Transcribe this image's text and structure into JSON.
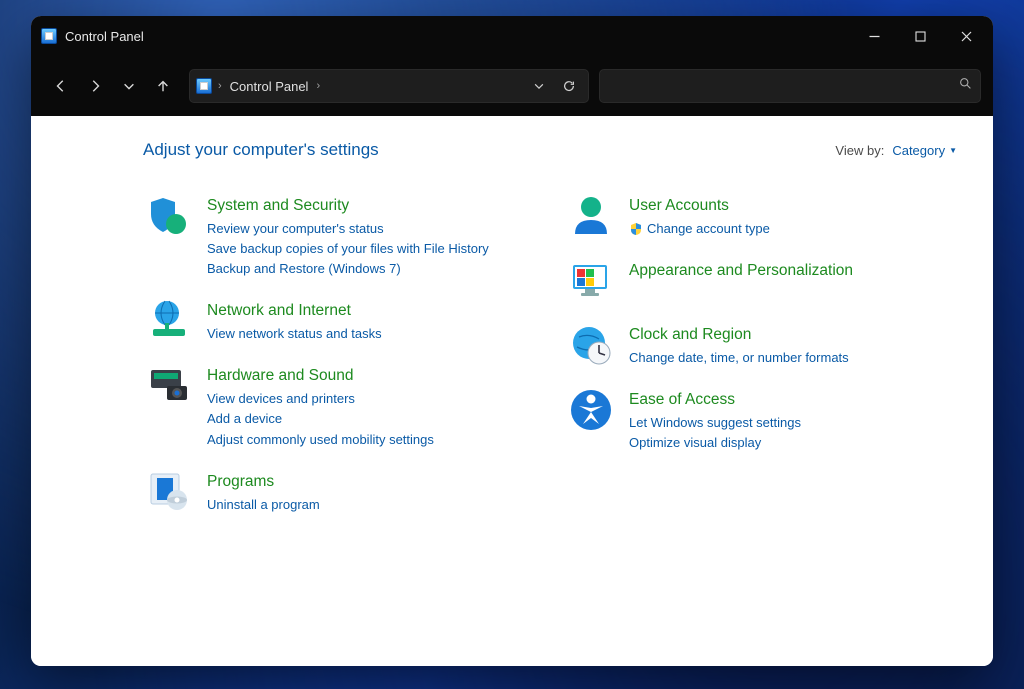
{
  "window": {
    "title": "Control Panel"
  },
  "breadcrumb": {
    "root": "Control Panel"
  },
  "search": {
    "placeholder": ""
  },
  "header": {
    "page_title": "Adjust your computer's settings",
    "viewby_label": "View by:",
    "viewby_value": "Category"
  },
  "categories": {
    "col1": [
      {
        "title": "System and Security",
        "links": [
          "Review your computer's status",
          "Save backup copies of your files with File History",
          "Backup and Restore (Windows 7)"
        ]
      },
      {
        "title": "Network and Internet",
        "links": [
          "View network status and tasks"
        ]
      },
      {
        "title": "Hardware and Sound",
        "links": [
          "View devices and printers",
          "Add a device",
          "Adjust commonly used mobility settings"
        ]
      },
      {
        "title": "Programs",
        "links": [
          "Uninstall a program"
        ]
      }
    ],
    "col2": [
      {
        "title": "User Accounts",
        "shielded_link": "Change account type"
      },
      {
        "title": "Appearance and Personalization",
        "links": []
      },
      {
        "title": "Clock and Region",
        "links": [
          "Change date, time, or number formats"
        ]
      },
      {
        "title": "Ease of Access",
        "links": [
          "Let Windows suggest settings",
          "Optimize visual display"
        ]
      }
    ]
  }
}
